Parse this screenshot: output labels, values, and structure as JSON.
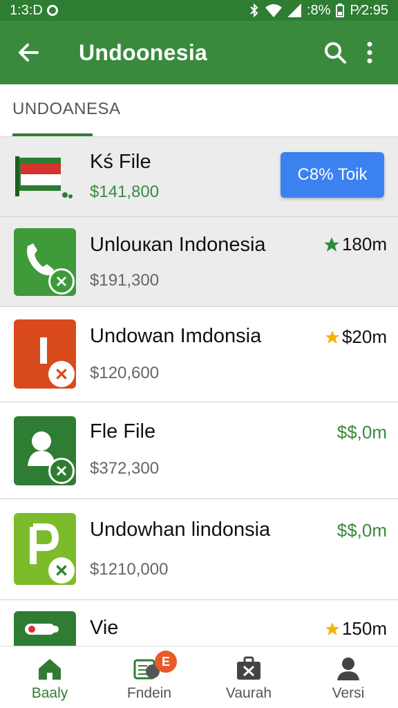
{
  "status_bar": {
    "time": "1:3:D",
    "battery": ":8%",
    "clock_right": "Ρ⁄2:95"
  },
  "app_bar": {
    "title": "Undoonesia"
  },
  "tabs": [
    {
      "label": "UNDOANESA",
      "active": true
    }
  ],
  "list": {
    "featured": {
      "name": "Kś File",
      "price": "$141,800",
      "action_label": "C8% Toik"
    },
    "items": [
      {
        "name": "Unlouкan Indonesia",
        "price": "$191,300",
        "meta": "180m",
        "meta_icon": "star-icon",
        "icon_color": "#3f9a3a"
      },
      {
        "name": "Undowan Imdonsia",
        "price": "$120,600",
        "meta": "$20m",
        "meta_icon": "star-icon",
        "icon_color": "#d84a1c"
      },
      {
        "name": "Fle File",
        "price": "$372,300",
        "meta": "$$,0m",
        "meta_icon": "",
        "icon_color": "#2e7d32"
      },
      {
        "name": "Undowhan lindonsia",
        "price": "$1210,000",
        "meta": "$$,0m",
        "meta_icon": "",
        "icon_color": "#7cbb2a"
      },
      {
        "name": "Vie",
        "price": "",
        "meta": "150m",
        "meta_icon": "star-icon",
        "icon_color": "#2e7d32"
      }
    ]
  },
  "bottom_nav": {
    "items": [
      {
        "label": "Baaly",
        "icon": "home-icon",
        "active": true
      },
      {
        "label": "Fndein",
        "icon": "camera-icon",
        "badge": "E"
      },
      {
        "label": "Vaurah",
        "icon": "briefcase-icon"
      },
      {
        "label": "Versi",
        "icon": "person-icon"
      }
    ]
  },
  "colors": {
    "primary": "#3a8a3e",
    "primary_dark": "#2e7d32",
    "accent_blue": "#3b82f0",
    "price_green": "#3a8a3e",
    "star_green": "#2e8b3a",
    "star_gold": "#f4b400"
  }
}
